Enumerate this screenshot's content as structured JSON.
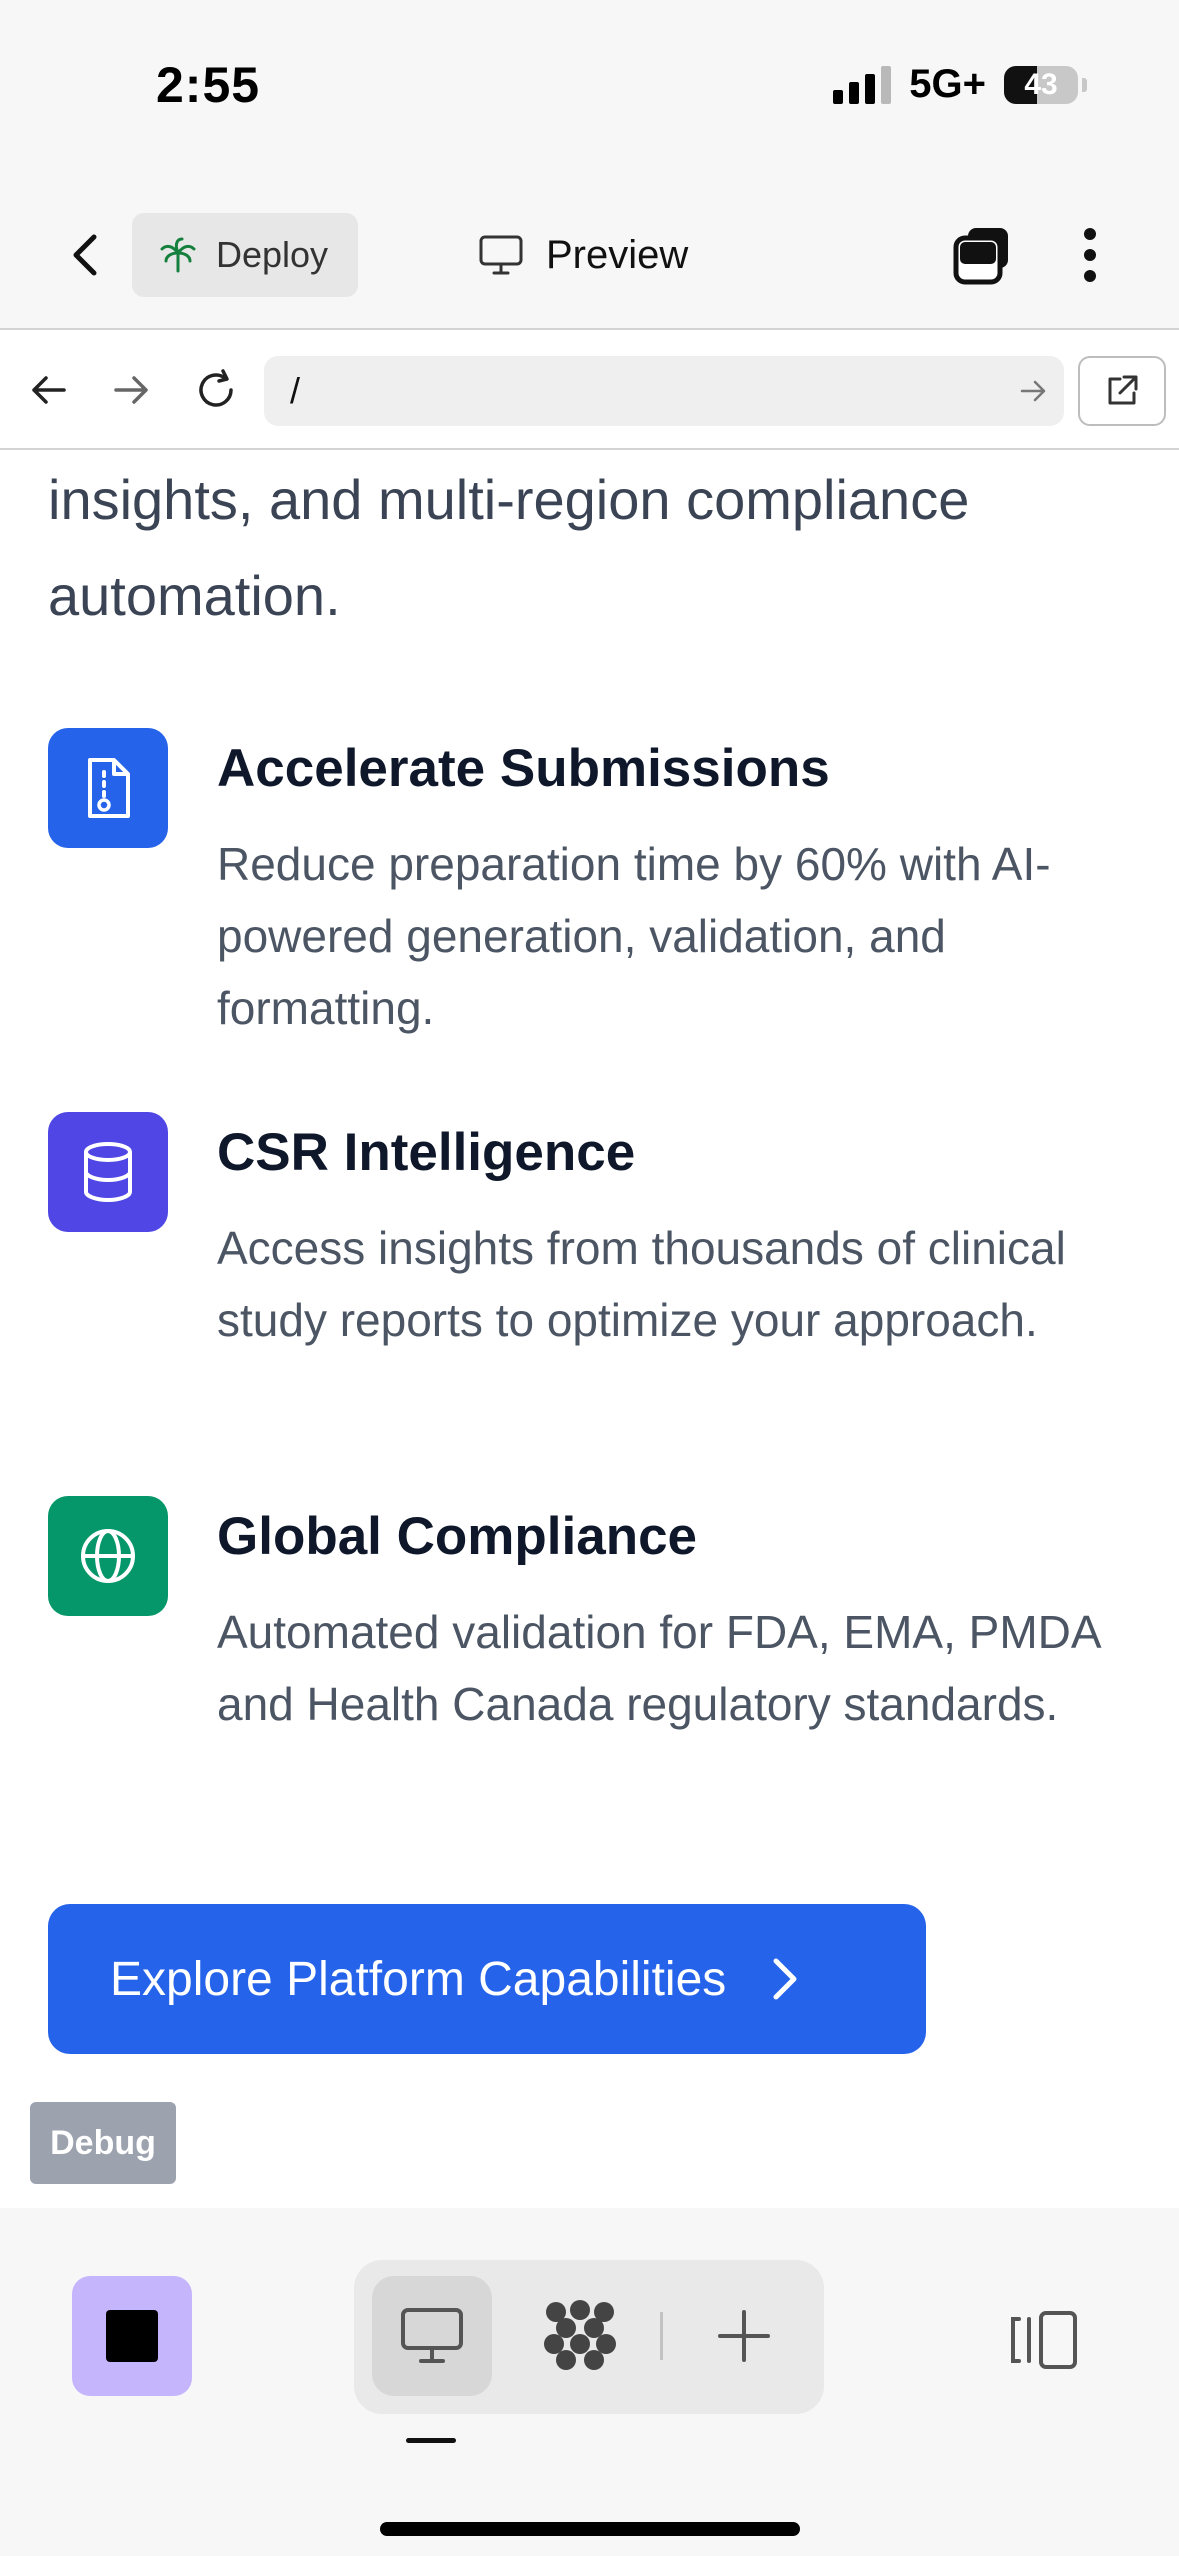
{
  "status_bar": {
    "time": "2:55",
    "network": "5G+",
    "battery": "43"
  },
  "toolbar": {
    "back_icon": "chevron-left-icon",
    "deploy_label": "Deploy",
    "deploy_icon": "palm-tree-icon",
    "preview_label": "Preview",
    "preview_icon": "monitor-icon",
    "tabs_icon": "tabs-stack-icon",
    "more_icon": "vertical-dots-icon"
  },
  "url_bar": {
    "path": "/",
    "back_icon": "arrow-left-icon",
    "forward_icon": "arrow-right-icon",
    "reload_icon": "reload-icon",
    "go_icon": "arrow-right-icon",
    "open_external_icon": "external-link-icon"
  },
  "page": {
    "intro_text": "insights, and multi-region compliance automation.",
    "features": [
      {
        "title": "Accelerate Submissions",
        "description": "Reduce preparation time by 60% with AI-powered generation, validation, and formatting.",
        "icon": "file-document-icon",
        "color": "#2563eb"
      },
      {
        "title": "CSR Intelligence",
        "description": "Access insights from thousands of clinical study reports to optimize your approach.",
        "icon": "database-icon",
        "color": "#4f46e5"
      },
      {
        "title": "Global Compliance",
        "description": "Automated validation for FDA, EMA, PMDA and Health Canada regulatory standards.",
        "icon": "globe-icon",
        "color": "#059669"
      }
    ],
    "cta_label": "Explore Platform Capabilities",
    "cta_icon": "chevron-right-icon",
    "debug_label": "Debug"
  },
  "bottom_bar": {
    "stop_icon": "stop-icon",
    "desktop_icon": "monitor-icon",
    "apps_icon": "apps-cluster-icon",
    "add_icon": "plus-icon",
    "panel_icon": "side-panel-icon"
  },
  "colors": {
    "accent": "#2563eb",
    "stop_button": "#c4b5fd",
    "chrome_background": "#f7f7f7"
  }
}
